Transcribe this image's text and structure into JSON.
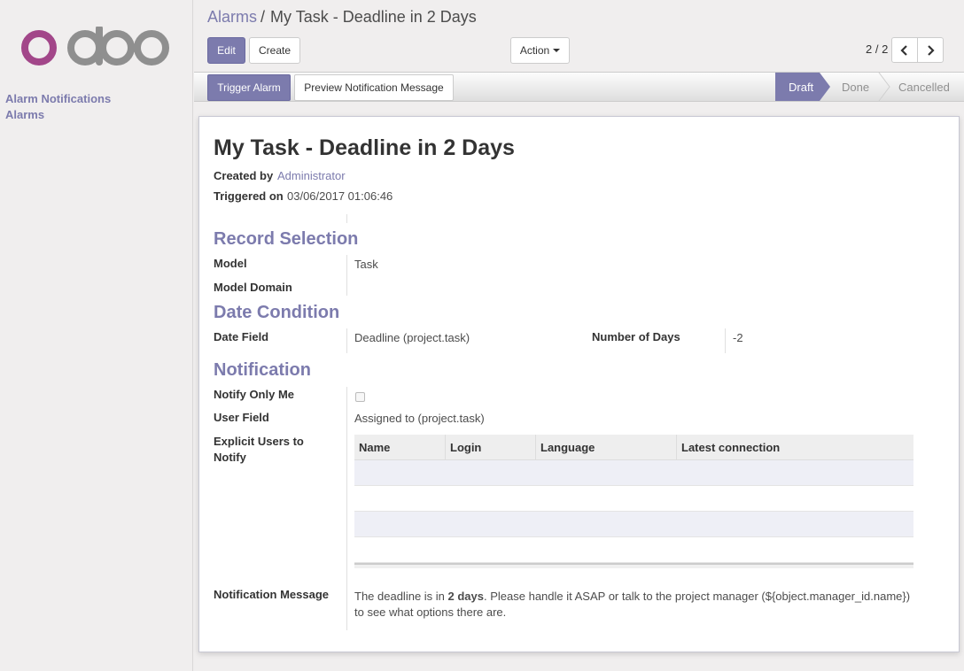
{
  "sidebar": {
    "items": [
      {
        "label": "Alarm Notifications"
      },
      {
        "label": "Alarms"
      }
    ]
  },
  "breadcrumb": {
    "parent": "Alarms",
    "separator": "/",
    "current": "My Task - Deadline in 2 Days"
  },
  "toolbar": {
    "edit_label": "Edit",
    "create_label": "Create",
    "action_label": "Action"
  },
  "pager": {
    "value": "2 / 2"
  },
  "statusbar": {
    "trigger_label": "Trigger Alarm",
    "preview_label": "Preview Notification Message",
    "stages": [
      {
        "label": "Draft",
        "active": true
      },
      {
        "label": "Done",
        "active": false
      },
      {
        "label": "Cancelled",
        "active": false
      }
    ]
  },
  "record": {
    "title": "My Task - Deadline in 2 Days",
    "created_by_label": "Created by",
    "created_by": "Administrator",
    "triggered_on_label": "Triggered on",
    "triggered_on": "03/06/2017 01:06:46"
  },
  "record_selection": {
    "heading": "Record Selection",
    "model_label": "Model",
    "model_value": "Task",
    "domain_label": "Model Domain"
  },
  "date_condition": {
    "heading": "Date Condition",
    "date_field_label": "Date Field",
    "date_field_value": "Deadline (project.task)",
    "days_label": "Number of Days",
    "days_value": "-2"
  },
  "notification": {
    "heading": "Notification",
    "notify_only_me_label": "Notify Only Me",
    "user_field_label": "User Field",
    "user_field_value": "Assigned to (project.task)",
    "explicit_users_label": "Explicit Users to Notify",
    "columns": [
      "Name",
      "Login",
      "Language",
      "Latest connection"
    ],
    "message_label": "Notification Message",
    "message_prefix": "The deadline is in ",
    "message_bold": "2 days",
    "message_suffix": ". Please handle it ASAP or talk to the project manager (${object.manager_id.name}) to see what options there are."
  },
  "colors": {
    "brand": "#7c7bad",
    "logo_o": "#a24689",
    "logo_gray": "#8f8f8f"
  }
}
